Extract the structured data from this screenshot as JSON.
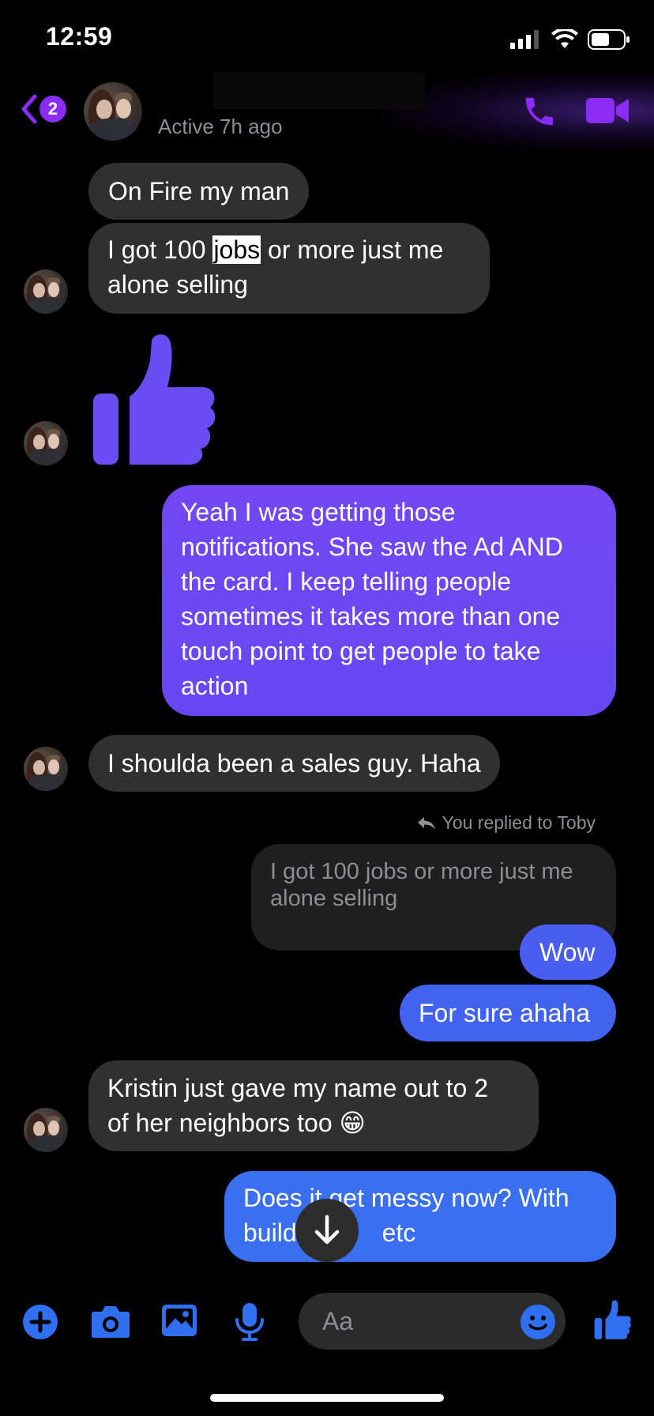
{
  "status_bar": {
    "time": "12:59"
  },
  "header": {
    "back_badge": "2",
    "active_status": "Active 7h ago"
  },
  "messages": {
    "m1": "On Fire my man",
    "m2_before": "I got 100 ",
    "m2_highlight": "jobs",
    "m2_after_line1": " or more just me",
    "m2_line2": "alone selling",
    "m3_lines": [
      "Yeah I was getting those",
      "notifications. She saw the Ad AND",
      "the card. I keep telling people",
      "sometimes it takes more than one",
      "touch point to get people to take",
      "action"
    ],
    "m4": "I shoulda been a sales guy.  Haha",
    "reply_label": "You replied to Toby",
    "quoted_line1": "I got 100 jobs or more just me",
    "quoted_line2": "alone selling",
    "m5": "Wow",
    "m6": "For sure ahaha",
    "m7_line1": "Kristin just gave my name out to 2",
    "m7_line2": "of her neighbors too",
    "m7_emoji": "😁",
    "m8_line1": "Does it get messy now? With",
    "m8_line2_part1": "build",
    "m8_line2_part2": "etc"
  },
  "composer": {
    "placeholder": "Aa"
  },
  "colors": {
    "accent": "#8b2cf5",
    "incoming_bubble": "#303030",
    "outgoing_purple": "#6747f2",
    "outgoing_blue": "#3f69f0",
    "composer_icons": "#2f6ff0"
  },
  "icons": {
    "back": "chevron-left-icon",
    "call": "phone-icon",
    "video": "video-camera-icon",
    "thumbs_up_sticker": "thumbs-up-icon",
    "reply": "reply-arrow-icon",
    "scroll": "arrow-down-icon",
    "add": "plus-icon",
    "camera": "camera-icon",
    "gallery": "image-icon",
    "mic": "microphone-icon",
    "emoji": "smiley-icon",
    "like": "thumbs-up-icon"
  }
}
